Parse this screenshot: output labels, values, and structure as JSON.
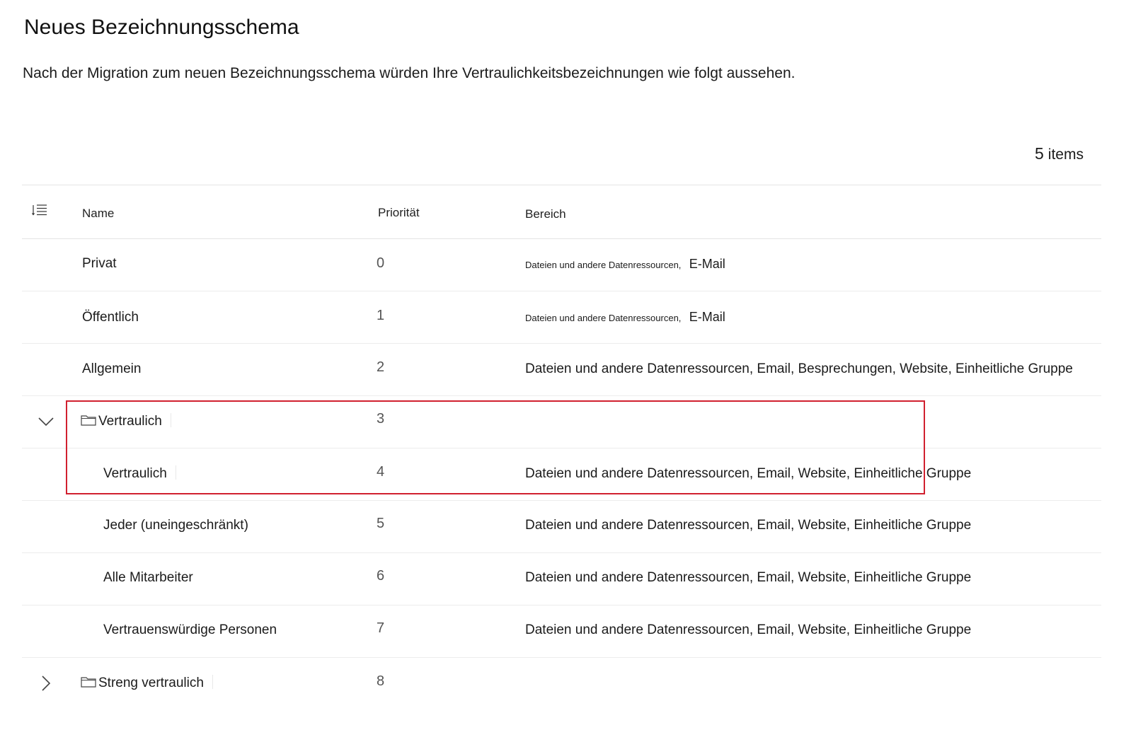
{
  "page": {
    "title": "Neues Bezeichnungsschema",
    "subtitle": "Nach der Migration zum neuen Bezeichnungsschema würden Ihre Vertraulichkeitsbezeichnungen wie folgt aussehen.",
    "items_count": "5",
    "items_label": "items"
  },
  "table": {
    "columns": {
      "list_icon": "list-icon",
      "name": "Name",
      "priority": "Priorität",
      "scope": "Bereich"
    },
    "rows": [
      {
        "name": "Privat",
        "priority": "0",
        "scope_small": "Dateien und andere Datenressourcen,",
        "scope": "E-Mail"
      },
      {
        "name": "Öffentlich",
        "priority": "1",
        "scope_small": "Dateien und andere Datenressourcen,",
        "scope": "E-Mail"
      },
      {
        "name": "Allgemein",
        "priority": "2",
        "scope": "Dateien und andere Datenressourcen, Email, Besprechungen, Website, Einheitliche Gruppe"
      },
      {
        "name": "Vertraulich",
        "priority": "3",
        "scope": "",
        "group": true,
        "expanded": true
      },
      {
        "name": "Vertraulich",
        "priority": "4",
        "scope": "Dateien und andere Datenressourcen, Email, Website, Einheitliche Gruppe",
        "child": true
      },
      {
        "name": "Jeder (uneingeschränkt)",
        "priority": "5",
        "scope": "Dateien und andere Datenressourcen, Email, Website, Einheitliche Gruppe",
        "child": true
      },
      {
        "name": "Alle Mitarbeiter",
        "priority": "6",
        "scope": "Dateien und andere Datenressourcen, Email, Website, Einheitliche Gruppe",
        "child": true
      },
      {
        "name": "Vertrauenswürdige Personen",
        "priority": "7",
        "scope": "Dateien und andere Datenressourcen, Email, Website, Einheitliche Gruppe",
        "child": true
      },
      {
        "name": "Streng vertraulich",
        "priority": "8",
        "scope": "",
        "group": true,
        "expanded": false
      }
    ]
  },
  "colors": {
    "highlight": "#d1202f",
    "text": "#1b1b1b",
    "divider": "#ececec"
  },
  "icons": {
    "column_picker": "list-icon",
    "expand_open": "chevron-down-icon",
    "expand_closed": "chevron-right-icon",
    "group": "folder-icon"
  }
}
